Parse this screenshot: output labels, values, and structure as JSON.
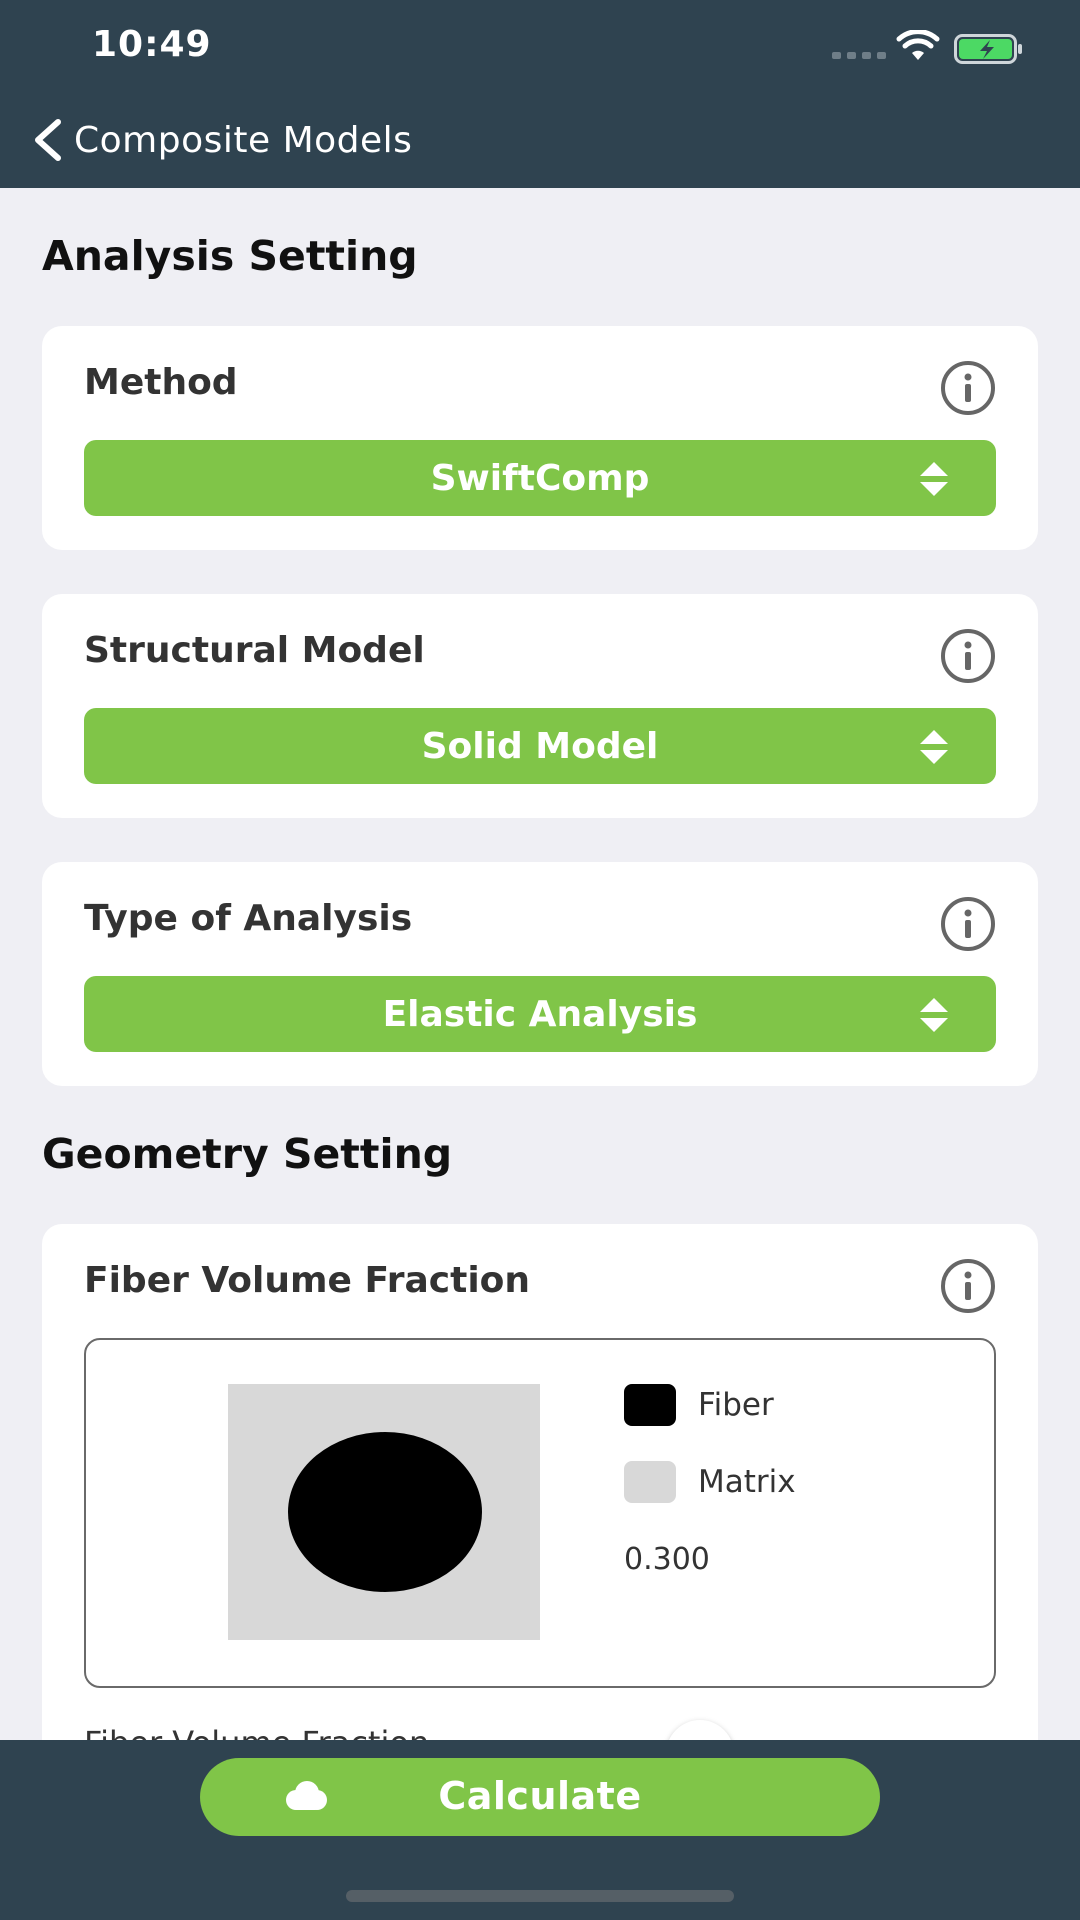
{
  "status_bar": {
    "time": "10:49"
  },
  "nav": {
    "back_label": "Composite Models"
  },
  "analysis": {
    "title": "Analysis Setting",
    "method": {
      "label": "Method",
      "value": "SwiftComp"
    },
    "structural_model": {
      "label": "Structural Model",
      "value": "Solid Model"
    },
    "type_of_analysis": {
      "label": "Type of Analysis",
      "value": "Elastic Analysis"
    }
  },
  "geometry": {
    "title": "Geometry Setting",
    "fiber_volume_fraction": {
      "label": "Fiber Volume Fraction",
      "legend": [
        {
          "label": "Fiber",
          "color": "#000000"
        },
        {
          "label": "Matrix",
          "color": "#d8d8d8"
        }
      ],
      "value": "0.300",
      "slider_label": "Fiber Volume Fraction"
    }
  },
  "bottom": {
    "calculate_label": "Calculate"
  },
  "colors": {
    "accent": "#80c548",
    "bar": "#2f4350",
    "background": "#efeff4"
  }
}
